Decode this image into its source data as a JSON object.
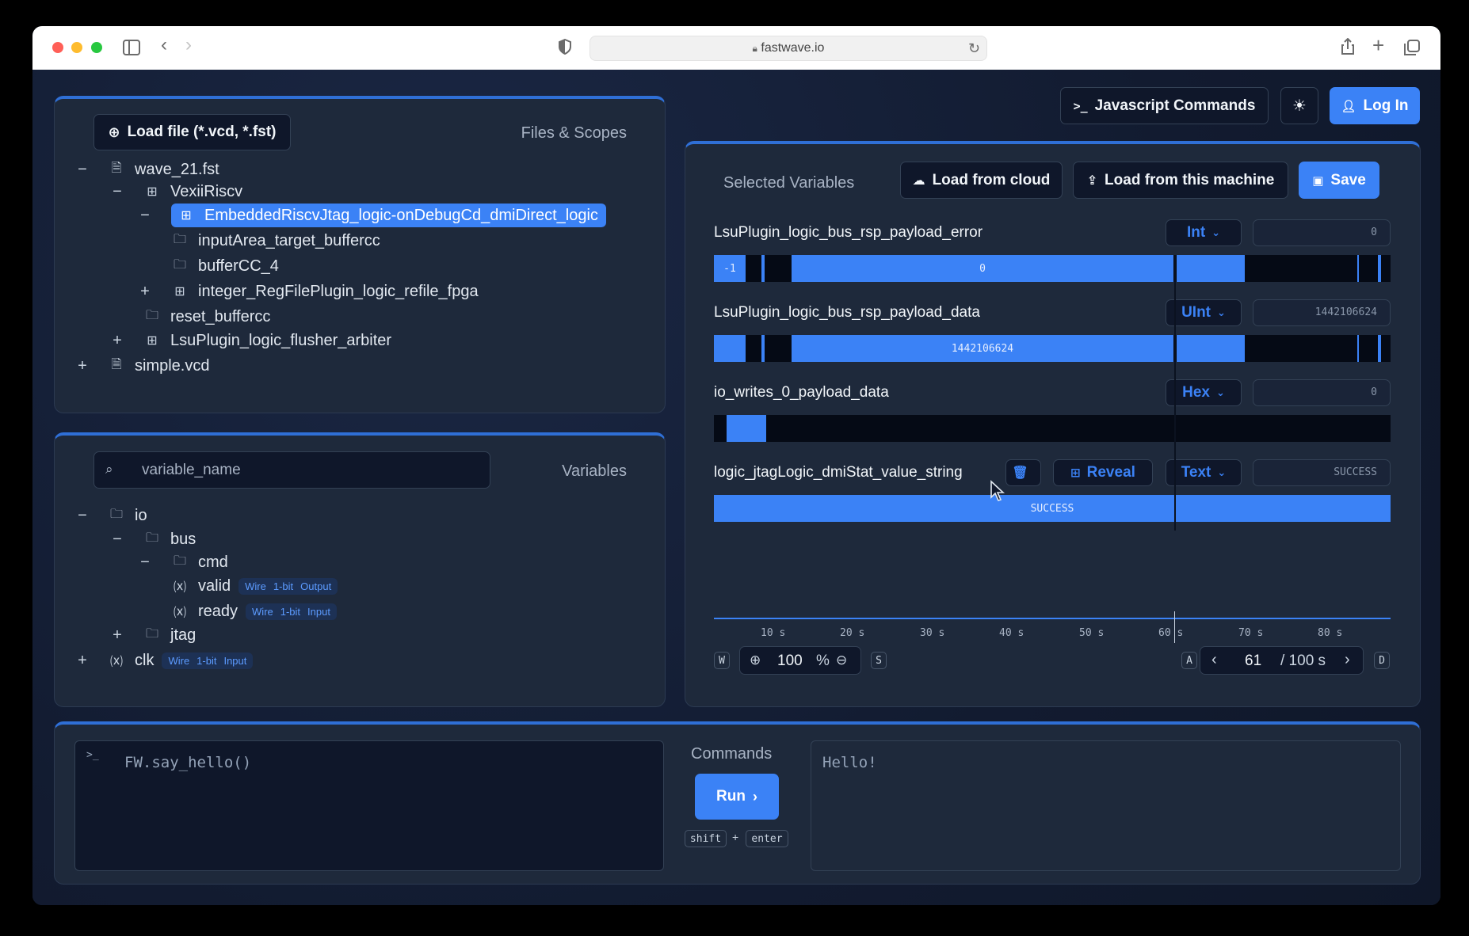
{
  "browser": {
    "url": "fastwave.io"
  },
  "header": {
    "js_commands_label": "Javascript Commands",
    "login_label": "Log In"
  },
  "files_panel": {
    "load_button": "Load file (*.vcd, *.fst)",
    "title": "Files & Scopes",
    "rows": [
      "wave_21.fst",
      "VexiiRiscv",
      "EmbeddedRiscvJtag_logic-onDebugCd_dmiDirect_logic",
      "inputArea_target_buffercc",
      "bufferCC_4",
      "integer_RegFilePlugin_logic_refile_fpga",
      "reset_buffercc",
      "LsuPlugin_logic_flusher_arbiter",
      "simple.vcd"
    ]
  },
  "variables_panel": {
    "search_placeholder": "variable_name",
    "title": "Variables",
    "rows": [
      "io",
      "bus",
      "cmd",
      "valid",
      "ready",
      "jtag",
      "clk"
    ],
    "badges": {
      "valid": [
        "Wire",
        "1-bit",
        "Output"
      ],
      "ready": [
        "Wire",
        "1-bit",
        "Input"
      ],
      "clk": [
        "Wire",
        "1-bit",
        "Input"
      ]
    }
  },
  "selected_panel": {
    "title": "Selected Variables",
    "load_cloud": "Load from cloud",
    "load_machine": "Load from this machine",
    "save": "Save",
    "delete_label": "",
    "reveal_label": "Reveal",
    "variables": [
      {
        "name": "LsuPlugin_logic_bus_rsp_payload_error",
        "format": "Int",
        "value": "0",
        "segments": [
          "-1",
          "0"
        ]
      },
      {
        "name": "LsuPlugin_logic_bus_rsp_payload_data",
        "format": "UInt",
        "value": "1442106624",
        "segments": [
          "1442106624"
        ]
      },
      {
        "name": "io_writes_0_payload_data",
        "format": "Hex",
        "value": "0",
        "segments": []
      },
      {
        "name": "logic_jtagLogic_dmiStat_value_string",
        "format": "Text",
        "value": "SUCCESS",
        "segments": [
          "SUCCESS"
        ]
      }
    ],
    "timeline_ticks": [
      "10 s",
      "20 s",
      "30 s",
      "40 s",
      "50 s",
      "60 s",
      "70 s",
      "80 s"
    ],
    "zoom": {
      "key_in": "W",
      "value": "100",
      "unit": "%",
      "key_out": "S"
    },
    "time": {
      "key_prev": "A",
      "current": "61",
      "total": "/ 100 s",
      "key_next": "D"
    }
  },
  "console": {
    "input": "FW.say_hello()",
    "commands_title": "Commands",
    "run_label": "Run",
    "shortcut": [
      "shift",
      "+",
      "enter"
    ],
    "output": "Hello!"
  },
  "colors": {
    "accent": "#3b82f6",
    "panel": "#1e293b",
    "background": "#16213a"
  }
}
